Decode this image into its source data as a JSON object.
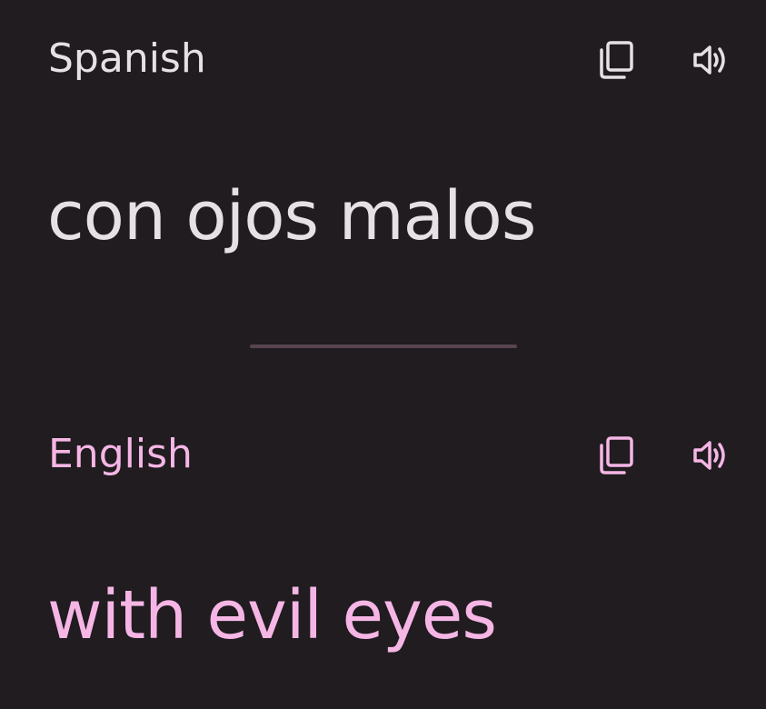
{
  "source": {
    "language": "Spanish",
    "text": "con ojos malos",
    "copy_icon": "copy-icon",
    "speak_icon": "speaker-icon"
  },
  "target": {
    "language": "English",
    "text": "with evil eyes",
    "copy_icon": "copy-icon",
    "speak_icon": "speaker-icon"
  },
  "colors": {
    "background": "#201c20",
    "source_text": "#e6e1e5",
    "target_text": "#f5b6e5",
    "divider": "#584450"
  }
}
